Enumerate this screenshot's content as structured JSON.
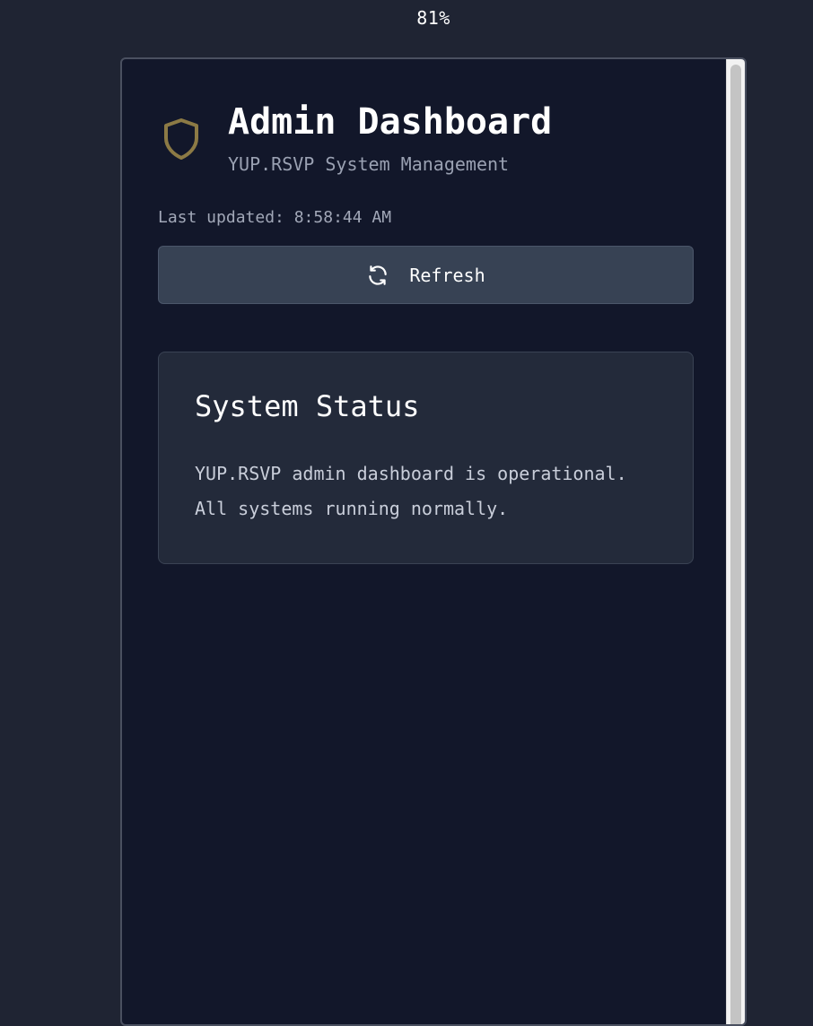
{
  "zoom": "81%",
  "header": {
    "title": "Admin Dashboard",
    "subtitle": "YUP.RSVP System Management",
    "icon": "shield-icon",
    "icon_color": "#8c7a45"
  },
  "status_bar": {
    "last_updated": "Last updated: 8:58:44 AM"
  },
  "toolbar": {
    "refresh_label": "Refresh",
    "refresh_icon": "refresh-icon"
  },
  "system_status": {
    "title": "System Status",
    "message": "YUP.RSVP admin dashboard is operational. All systems running normally."
  },
  "colors": {
    "background": "#1f2433",
    "panel": "#12172a",
    "card": "#232a3a",
    "button": "#374254"
  }
}
